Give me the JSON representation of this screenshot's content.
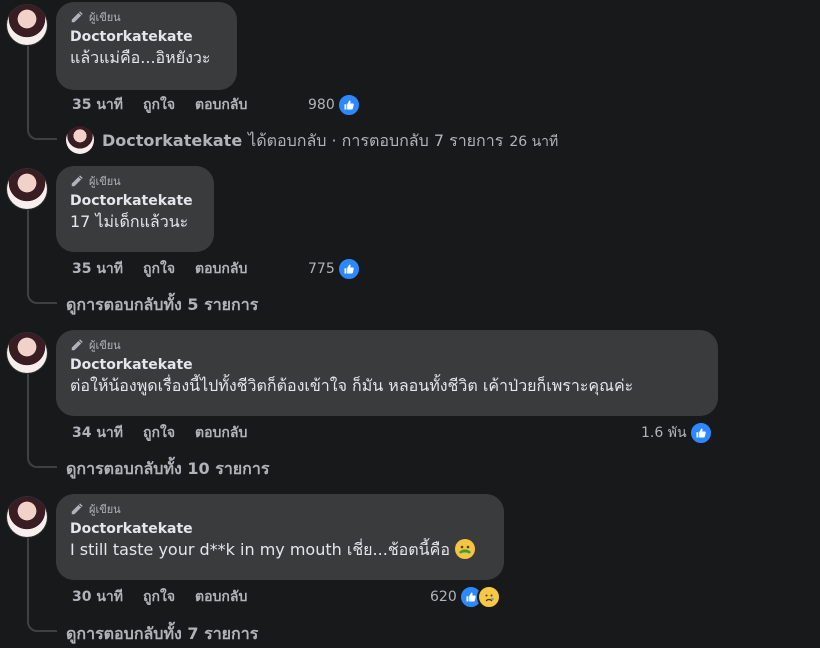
{
  "comments": [
    {
      "badge": "ผู้เขียน",
      "author": "Doctorkatekate",
      "text": "แล้วแม่คือ...อิหยังวะ",
      "time": "35 นาที",
      "like_label": "ถูกใจ",
      "reply_label": "ตอบกลับ",
      "reaction_count": "980",
      "reply_summary": {
        "name": "Doctorkatekate",
        "text": "ได้ตอบกลับ · การตอบกลับ 7 รายการ",
        "time": "26 นาที"
      }
    },
    {
      "badge": "ผู้เขียน",
      "author": "Doctorkatekate",
      "text": "17 ไม่เด็กแล้วนะ",
      "time": "35 นาที",
      "like_label": "ถูกใจ",
      "reply_label": "ตอบกลับ",
      "reaction_count": "775",
      "view_replies": "ดูการตอบกลับทั้ง 5 รายการ"
    },
    {
      "badge": "ผู้เขียน",
      "author": "Doctorkatekate",
      "text": "ต่อให้น้องพูดเรื่องนี้ไปทั้งชีวิตก็ต้องเข้าใจ ก็มัน หลอนทั้งชีวิต เค้าป่วยก็เพราะคุณค่ะ",
      "time": "34 นาที",
      "like_label": "ถูกใจ",
      "reply_label": "ตอบกลับ",
      "reaction_count": "1.6 พัน",
      "view_replies": "ดูการตอบกลับทั้ง 10 รายการ"
    },
    {
      "badge": "ผู้เขียน",
      "author": "Doctorkatekate",
      "text": "I still taste your d**k in my mouth เชี่ย...ช้อตนี้คือ",
      "time": "30 นาที",
      "like_label": "ถูกใจ",
      "reply_label": "ตอบกลับ",
      "reaction_count": "620",
      "view_replies": "ดูการตอบกลับทั้ง 7 รายการ"
    }
  ],
  "icons": {
    "badge": "pencil-icon",
    "like": "like-icon",
    "sad": "sad-icon",
    "sick": "sick-emoji-icon"
  },
  "colors": {
    "background": "#18191a",
    "bubble": "#3a3b3c",
    "like_blue": "#2d88ff",
    "text_primary": "#e4e6eb",
    "text_secondary": "#b0b3b8"
  }
}
